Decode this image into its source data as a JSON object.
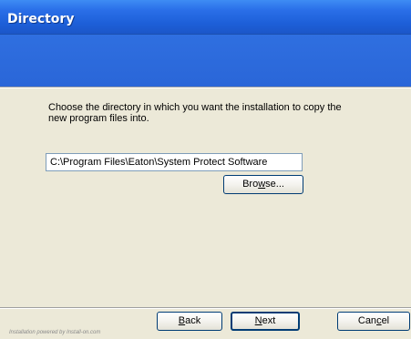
{
  "window": {
    "title": "Directory"
  },
  "content": {
    "instruction": "Choose the directory in which you want the installation to copy the new program files into.",
    "path_value": "C:\\Program Files\\Eaton\\System Protect Software"
  },
  "buttons": {
    "browse_pre": "Bro",
    "browse_u": "w",
    "browse_post": "se...",
    "back_u": "B",
    "back_post": "ack",
    "next_u": "N",
    "next_post": "ext",
    "cancel_pre": "Can",
    "cancel_u": "c",
    "cancel_post": "el"
  },
  "footer": {
    "watermark": "Installation powered by Install-on.com"
  },
  "colors": {
    "titlebar": "#1d5fd8",
    "banner": "#2a66d8",
    "background": "#ece9d8",
    "button_border": "#003c74"
  }
}
